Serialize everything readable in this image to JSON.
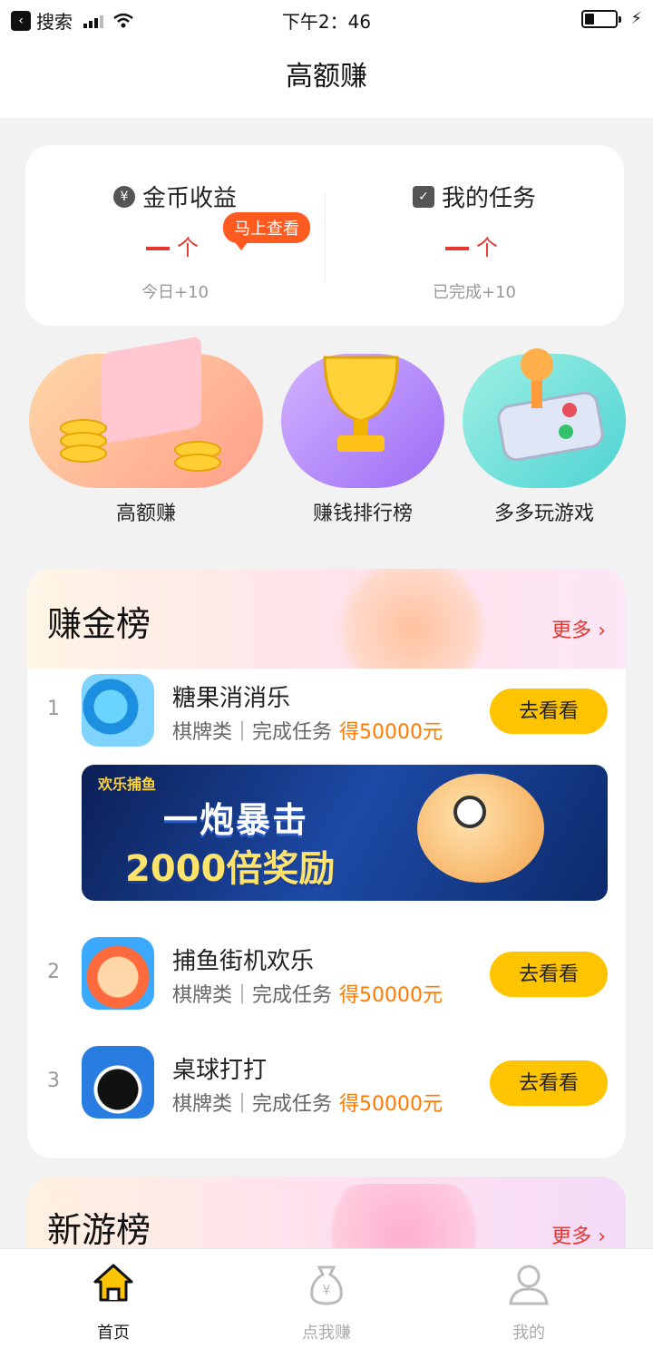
{
  "status_bar": {
    "back_app": "搜索",
    "time": "下午2：46"
  },
  "nav": {
    "title": "高额赚"
  },
  "summary": {
    "coins": {
      "title": "金币收益",
      "value": "个",
      "sub": "今日+10",
      "badge": "马上查看"
    },
    "tasks": {
      "title": "我的任务",
      "value": "个",
      "sub": "已完成+10"
    }
  },
  "features": [
    {
      "label": "高额赚",
      "icon": "money-stack-icon"
    },
    {
      "label": "赚钱排行榜",
      "icon": "trophy-icon"
    },
    {
      "label": "多多玩游戏",
      "icon": "joystick-icon"
    }
  ],
  "earn_list": {
    "title": "赚金榜",
    "more": "更多",
    "items": [
      {
        "rank": "1",
        "name": "糖果消消乐",
        "category": "棋牌类｜完成任务",
        "reward": "得50000元",
        "button": "去看看"
      },
      {
        "rank": "2",
        "name": "捕鱼街机欢乐",
        "category": "棋牌类｜完成任务",
        "reward": "得50000元",
        "button": "去看看"
      },
      {
        "rank": "3",
        "name": "桌球打打",
        "category": "棋牌类｜完成任务",
        "reward": "得50000元",
        "button": "去看看"
      }
    ],
    "banner": {
      "logo": "欢乐捕鱼",
      "line1": "一炮暴击",
      "line2": "2000倍奖励"
    }
  },
  "new_list": {
    "title": "新游榜",
    "more": "更多"
  },
  "tabbar": [
    {
      "label": "首页",
      "icon": "home-icon",
      "active": true
    },
    {
      "label": "点我赚",
      "icon": "money-bag-icon",
      "active": false
    },
    {
      "label": "我的",
      "icon": "user-icon",
      "active": false
    }
  ],
  "colors": {
    "accent": "#ffc400",
    "reward": "#ff7a00",
    "red": "#e8362f"
  }
}
